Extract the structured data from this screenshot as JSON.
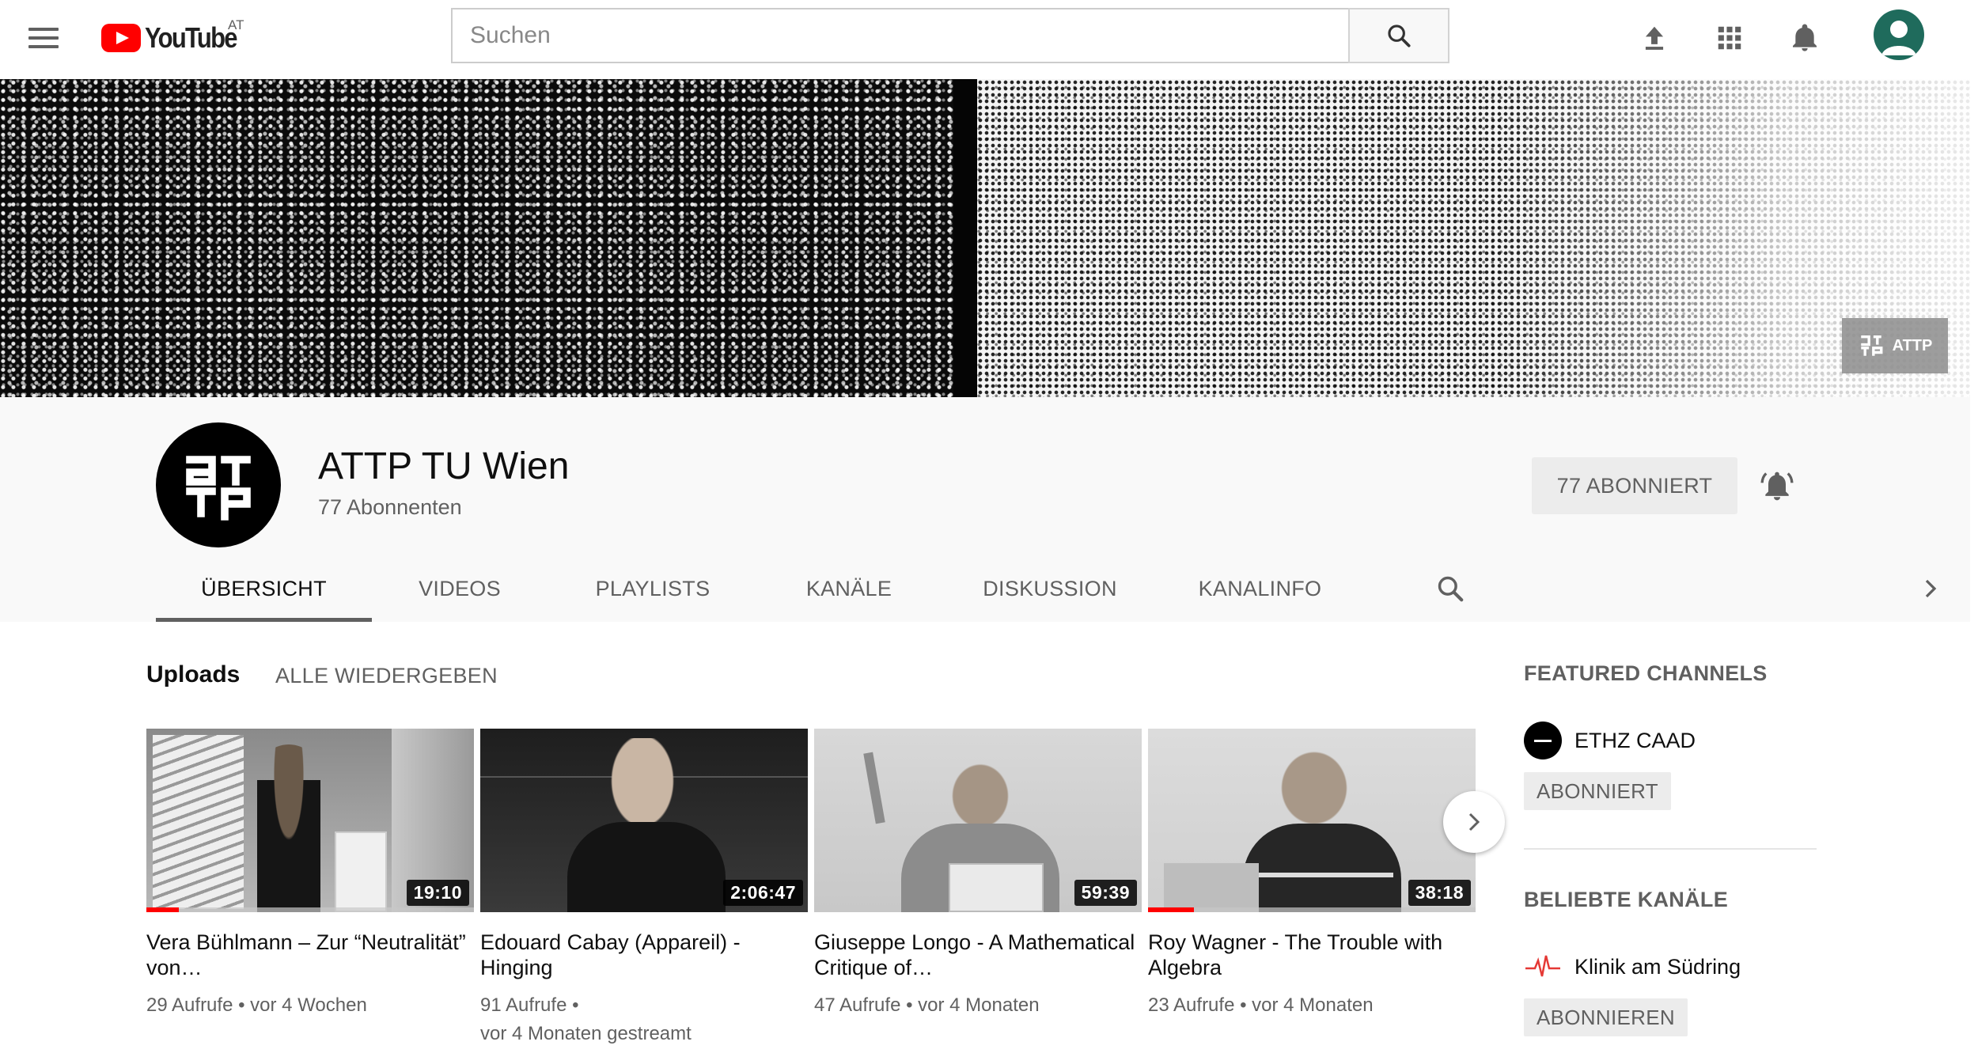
{
  "masthead": {
    "logo_text": "YouTube",
    "country_code": "AT",
    "search_placeholder": "Suchen",
    "icons": [
      "menu-icon",
      "upload-icon",
      "apps-icon",
      "notifications-icon",
      "account-icon"
    ]
  },
  "banner": {
    "link_label": "ATTP"
  },
  "channel": {
    "name": "ATTP TU Wien",
    "subscribers": "77 Abonnenten",
    "subscribe_button": "77 ABONNIERT",
    "tabs": [
      {
        "label": "ÜBERSICHT",
        "active": true
      },
      {
        "label": "VIDEOS",
        "active": false
      },
      {
        "label": "PLAYLISTS",
        "active": false
      },
      {
        "label": "KANÄLE",
        "active": false
      },
      {
        "label": "DISKUSSION",
        "active": false
      },
      {
        "label": "KANALINFO",
        "active": false
      }
    ]
  },
  "uploads": {
    "title": "Uploads",
    "play_all": "ALLE WIEDERGEBEN",
    "videos": [
      {
        "title": "Vera Bühlmann – Zur “Neutralität” von…",
        "duration": "19:10",
        "meta1": "29 Aufrufe • vor 4 Wochen",
        "meta2": "",
        "watched": 0.1
      },
      {
        "title": "Edouard Cabay (Appareil) - Hinging",
        "duration": "2:06:47",
        "meta1": "91 Aufrufe •",
        "meta2": "vor 4 Monaten gestreamt",
        "watched": 0
      },
      {
        "title": "Giuseppe Longo - A Mathematical Critique of…",
        "duration": "59:39",
        "meta1": "47 Aufrufe • vor 4 Monaten",
        "meta2": "",
        "watched": 0
      },
      {
        "title": "Roy Wagner - The Trouble with Algebra",
        "duration": "38:18",
        "meta1": "23 Aufrufe • vor 4 Monaten",
        "meta2": "",
        "watched": 0.14
      }
    ]
  },
  "sidebar": {
    "featured_heading": "FEATURED CHANNELS",
    "featured": [
      {
        "name": "ETHZ CAAD",
        "button": "ABONNIERT"
      }
    ],
    "popular_heading": "BELIEBTE KANÄLE",
    "popular": [
      {
        "name": "Klinik am Südring",
        "button": "ABONNIEREN"
      }
    ]
  },
  "colors": {
    "brand_red": "#ff0000",
    "text_secondary": "#606060",
    "chip_bg": "#ececec"
  }
}
